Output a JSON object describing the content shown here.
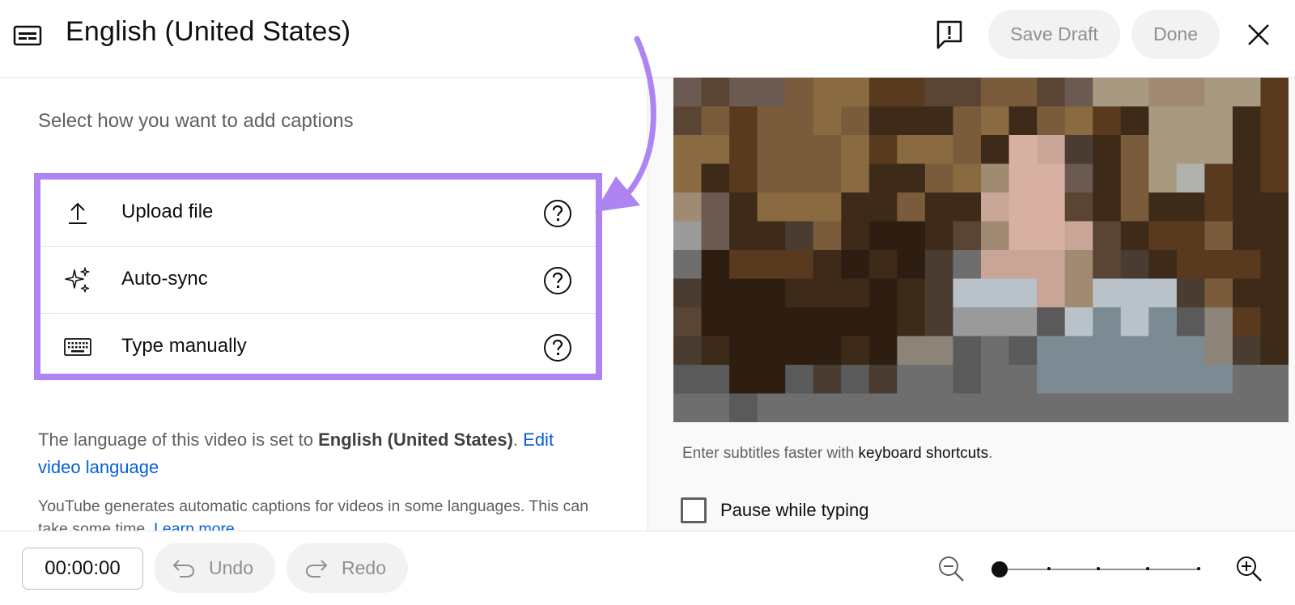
{
  "header": {
    "title": "English (United States)",
    "save_draft_label": "Save Draft",
    "done_label": "Done",
    "icons": {
      "subtitles": "subtitles-icon",
      "feedback": "feedback-icon",
      "close": "close-icon"
    }
  },
  "main": {
    "heading": "Select how you want to add captions",
    "options": [
      {
        "label": "Upload file",
        "icon": "upload-icon"
      },
      {
        "label": "Auto-sync",
        "icon": "sparkle-icon"
      },
      {
        "label": "Type manually",
        "icon": "keyboard-icon"
      }
    ],
    "language_note": {
      "prefix": "The language of this video is set to ",
      "language": "English (United States)",
      "separator": ". ",
      "edit_link": "Edit video language"
    },
    "auto_note": {
      "text": "YouTube generates automatic captions for videos in some languages. This can take some time. ",
      "learn_more": "Learn more"
    }
  },
  "preview": {
    "shortcut_prefix": "Enter subtitles faster with ",
    "shortcut_link": "keyboard shortcuts",
    "shortcut_suffix": ".",
    "pause_label": "Pause while typing",
    "pause_checked": false
  },
  "footer": {
    "timecode": "00:00:00",
    "undo_label": "Undo",
    "redo_label": "Redo",
    "zoom_level": 0
  },
  "colors": {
    "accent_highlight": "#ad84f2",
    "link": "#065fd4",
    "button_bg": "#f2f2f2",
    "button_text": "#909090"
  }
}
